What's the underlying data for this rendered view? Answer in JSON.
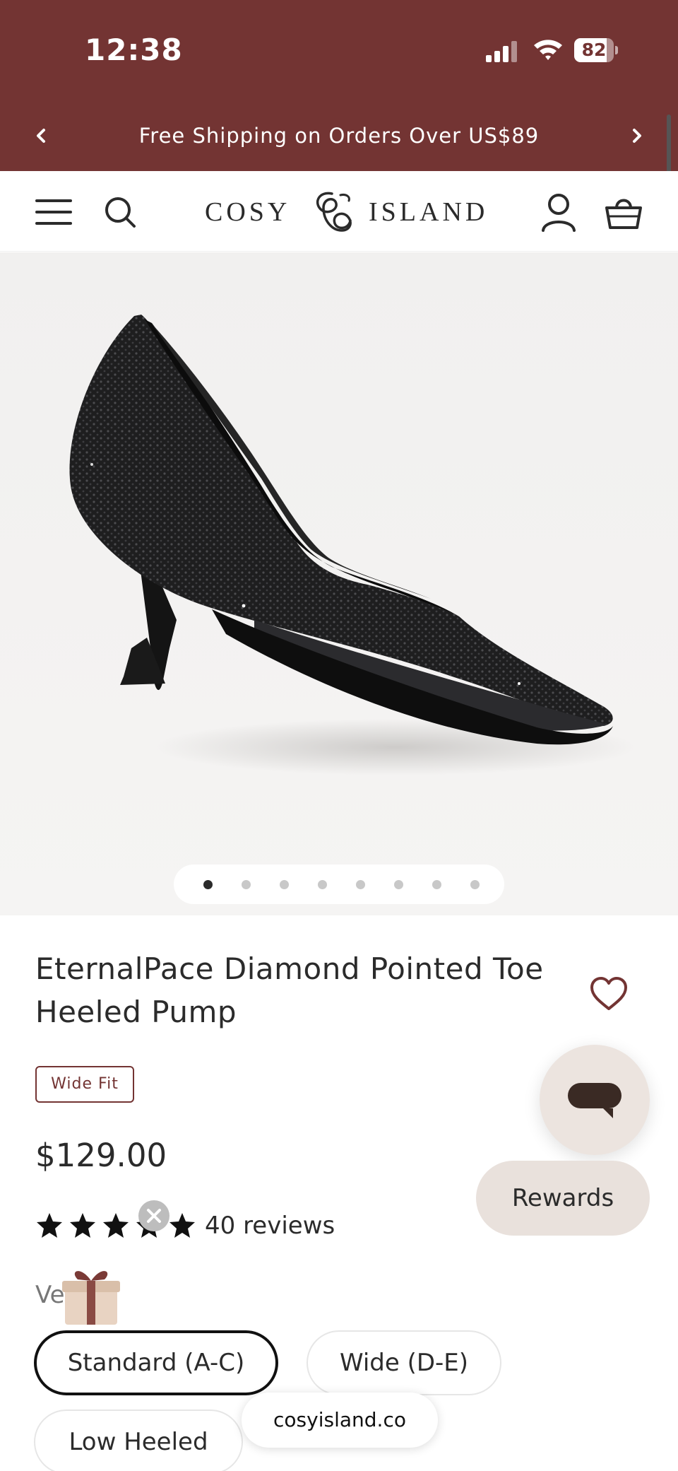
{
  "status_bar": {
    "time": "12:38",
    "battery": "82",
    "battery_level": 0.82,
    "signal_icon": "cellular-signal-icon",
    "wifi_icon": "wifi-icon"
  },
  "announcement": {
    "text": "Free Shipping on Orders Over US$89",
    "prev_icon": "chevron-left-icon",
    "next_icon": "chevron-right-icon"
  },
  "header": {
    "logo_left": "COSY",
    "logo_right": "ISLAND",
    "icons": [
      "hamburger-menu-icon",
      "search-icon",
      "account-icon",
      "cart-basket-icon"
    ]
  },
  "gallery": {
    "image": "black rhinestone pointed-toe pump",
    "slide_count": 8,
    "active_slide": 1
  },
  "product": {
    "title": "EternalPace Diamond Pointed Toe Heeled Pump",
    "badge": "Wide Fit",
    "price": "$129.00",
    "rating": 5,
    "reviews": "40 reviews",
    "variant_label": "Version:",
    "variant_label_visible": "Ve n:",
    "options": [
      "Standard (A-C)",
      "Wide (D-E)",
      "Low Heeled"
    ],
    "selected_option": "Standard (A-C)"
  },
  "floating": {
    "rewards": "Rewards",
    "chat_icon": "chat-bubble-icon",
    "gift_icon": "gift-box-icon",
    "close_icon": "close-icon"
  },
  "browser": {
    "url": "cosyisland.co"
  },
  "colors": {
    "brand": "#733433",
    "text": "#2b2b2b",
    "chip_bg": "#e9e1dc"
  }
}
